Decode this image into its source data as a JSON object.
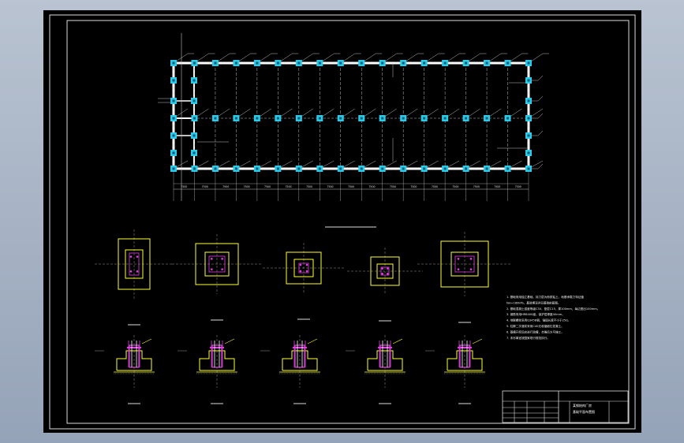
{
  "app": {
    "background": "#aab6c8",
    "canvas_color": "#000000",
    "frame_color": "#e6e6e6"
  },
  "drawing": {
    "bay_dimensions": [
      "7500",
      "7500",
      "7500",
      "7500",
      "7500",
      "7500",
      "7500",
      "7500",
      "7500",
      "7500",
      "7500",
      "7500",
      "7500",
      "7500",
      "7500",
      "7500",
      "7500"
    ],
    "notes": [
      "1. 基础采用独立基础，持力层为粉质粘土，地基承载力特征值",
      "   fak=180kPa，基础埋深详见基础剖面图。",
      "2. 基础混凝土强度等级C30，垫层C15，厚100mm，每边宽出100mm。",
      "3. 钢筋采用HRB400级，保护层厚度40mm。",
      "4. 地脚螺栓采用Q345B钢，锚固长度不小于25d。",
      "5. 柱脚二次灌浆采用C40无收缩细石混凝土。",
      "6. 基槽开挖后应进行验槽，合格后方可施工。",
      "7. 未尽事宜按国家现行规范执行。"
    ],
    "title_block": {
      "project": "某钢结构厂房",
      "sheet": "基础平面布置图"
    }
  },
  "colors": {
    "line_white": "#ffffff",
    "column_cyan": "#2ec8e8",
    "footing_yellow": "#ffff33",
    "bolt_magenta": "#e040e0",
    "dim_gray": "#bfbfbf"
  }
}
